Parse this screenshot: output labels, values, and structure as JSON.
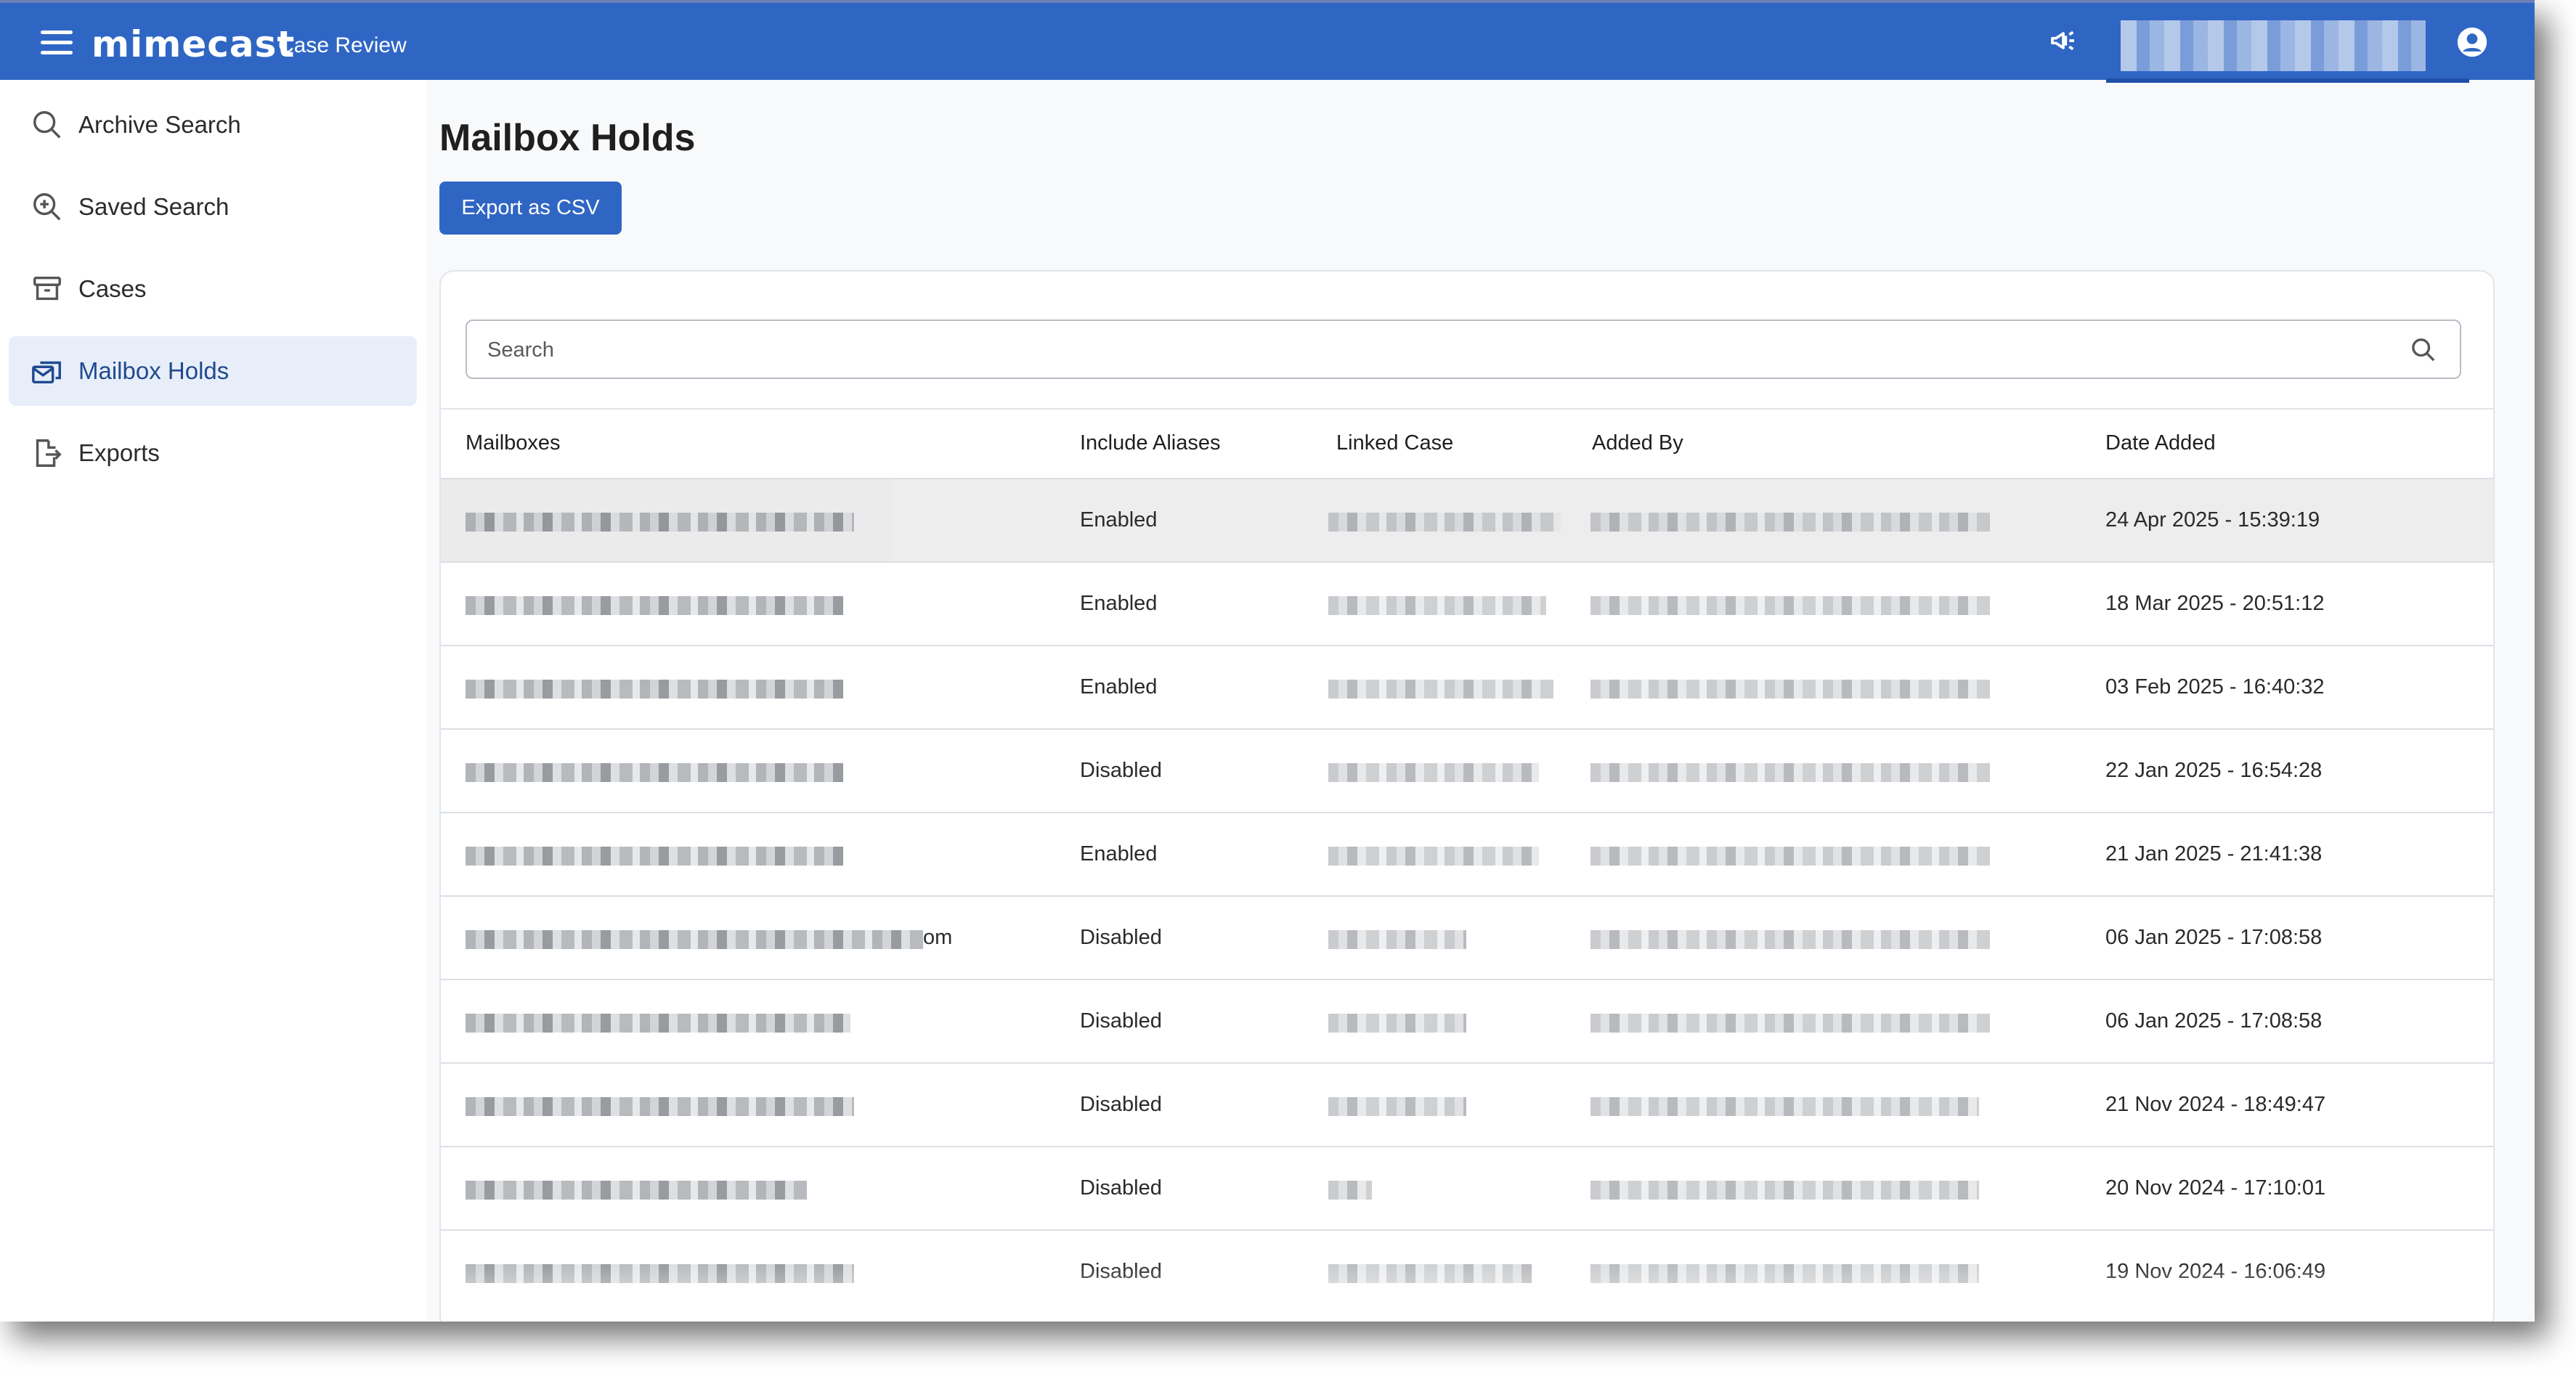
{
  "header": {
    "brand": "mimecast",
    "product": "Case Review",
    "color": "#2f66c4"
  },
  "sidebar": {
    "items": [
      {
        "label": "Archive Search",
        "icon": "search-icon"
      },
      {
        "label": "Saved Search",
        "icon": "zoom-plus-icon"
      },
      {
        "label": "Cases",
        "icon": "archive-box-icon"
      },
      {
        "label": "Mailbox Holds",
        "icon": "mailbox-hold-icon",
        "active": true
      },
      {
        "label": "Exports",
        "icon": "export-file-icon"
      }
    ]
  },
  "main": {
    "title": "Mailbox Holds",
    "export_label": "Export as CSV",
    "search_placeholder": "Search",
    "columns": [
      "Mailboxes",
      "Include Aliases",
      "Linked Case",
      "Added By",
      "Date Added"
    ],
    "rows": [
      {
        "aliases": "Enabled",
        "date": "24 Apr 2025 - 15:39:19",
        "mailbox_suffix": ""
      },
      {
        "aliases": "Enabled",
        "date": "18 Mar 2025 - 20:51:12",
        "mailbox_suffix": ""
      },
      {
        "aliases": "Enabled",
        "date": "03 Feb 2025 - 16:40:32",
        "mailbox_suffix": ""
      },
      {
        "aliases": "Disabled",
        "date": "22 Jan 2025 - 16:54:28",
        "mailbox_suffix": ""
      },
      {
        "aliases": "Enabled",
        "date": "21 Jan 2025 - 21:41:38",
        "mailbox_suffix": ""
      },
      {
        "aliases": "Disabled",
        "date": "06 Jan 2025 - 17:08:58",
        "mailbox_suffix": "om"
      },
      {
        "aliases": "Disabled",
        "date": "06 Jan 2025 - 17:08:58",
        "mailbox_suffix": ""
      },
      {
        "aliases": "Disabled",
        "date": "21 Nov 2024 - 18:49:47",
        "mailbox_suffix": ""
      },
      {
        "aliases": "Disabled",
        "date": "20 Nov 2024 - 17:10:01",
        "mailbox_suffix": ""
      },
      {
        "aliases": "Disabled",
        "date": "19 Nov 2024 - 16:06:49",
        "mailbox_suffix": ""
      }
    ]
  }
}
